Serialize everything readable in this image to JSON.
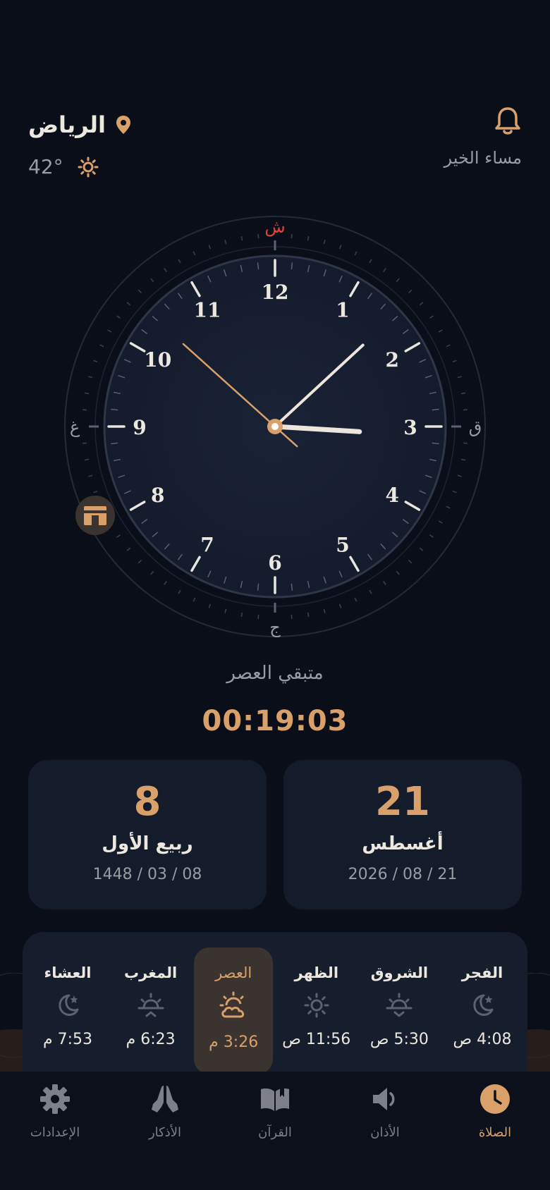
{
  "header": {
    "city": "الرياض",
    "temperature": "42°",
    "greeting": "مساء الخير"
  },
  "clock": {
    "numbers": [
      "12",
      "1",
      "2",
      "3",
      "4",
      "5",
      "6",
      "7",
      "8",
      "9",
      "10",
      "11"
    ],
    "compass": {
      "north": "ش",
      "east": "ق",
      "south": "ج",
      "west": "غ"
    },
    "time": {
      "hour": 3,
      "minute": 7,
      "second": 52
    }
  },
  "countdown": {
    "label": "متبقي العصر",
    "value": "00:19:03"
  },
  "dates": {
    "hijri": {
      "day": "8",
      "month": "ربيع الأول",
      "full": "1448 / 03 / 08"
    },
    "gregorian": {
      "day": "21",
      "month": "أغسطس",
      "full": "2026 / 08 / 21"
    }
  },
  "prayers": [
    {
      "name": "الفجر",
      "time": "4:08 ص",
      "icon": "moon-star-icon",
      "active": false
    },
    {
      "name": "الشروق",
      "time": "5:30 ص",
      "icon": "sunrise-icon",
      "active": false
    },
    {
      "name": "الظهر",
      "time": "11:56 ص",
      "icon": "sun-icon",
      "active": false
    },
    {
      "name": "العصر",
      "time": "3:26 م",
      "icon": "sun-cloud-icon",
      "active": true
    },
    {
      "name": "المغرب",
      "time": "6:23 م",
      "icon": "sunset-icon",
      "active": false
    },
    {
      "name": "العشاء",
      "time": "7:53 م",
      "icon": "moon-star-icon",
      "active": false
    }
  ],
  "nav": [
    {
      "label": "الصلاة",
      "icon": "clock-icon",
      "active": true
    },
    {
      "label": "الأذان",
      "icon": "speaker-icon",
      "active": false
    },
    {
      "label": "القرآن",
      "icon": "book-icon",
      "active": false
    },
    {
      "label": "الأذكار",
      "icon": "praying-hands-icon",
      "active": false
    },
    {
      "label": "الإعدادات",
      "icon": "gear-icon",
      "active": false
    }
  ],
  "colors": {
    "accent": "#d9a06a",
    "background": "#0a0e18",
    "card": "#141b2b",
    "north_marker": "#e0453a"
  }
}
